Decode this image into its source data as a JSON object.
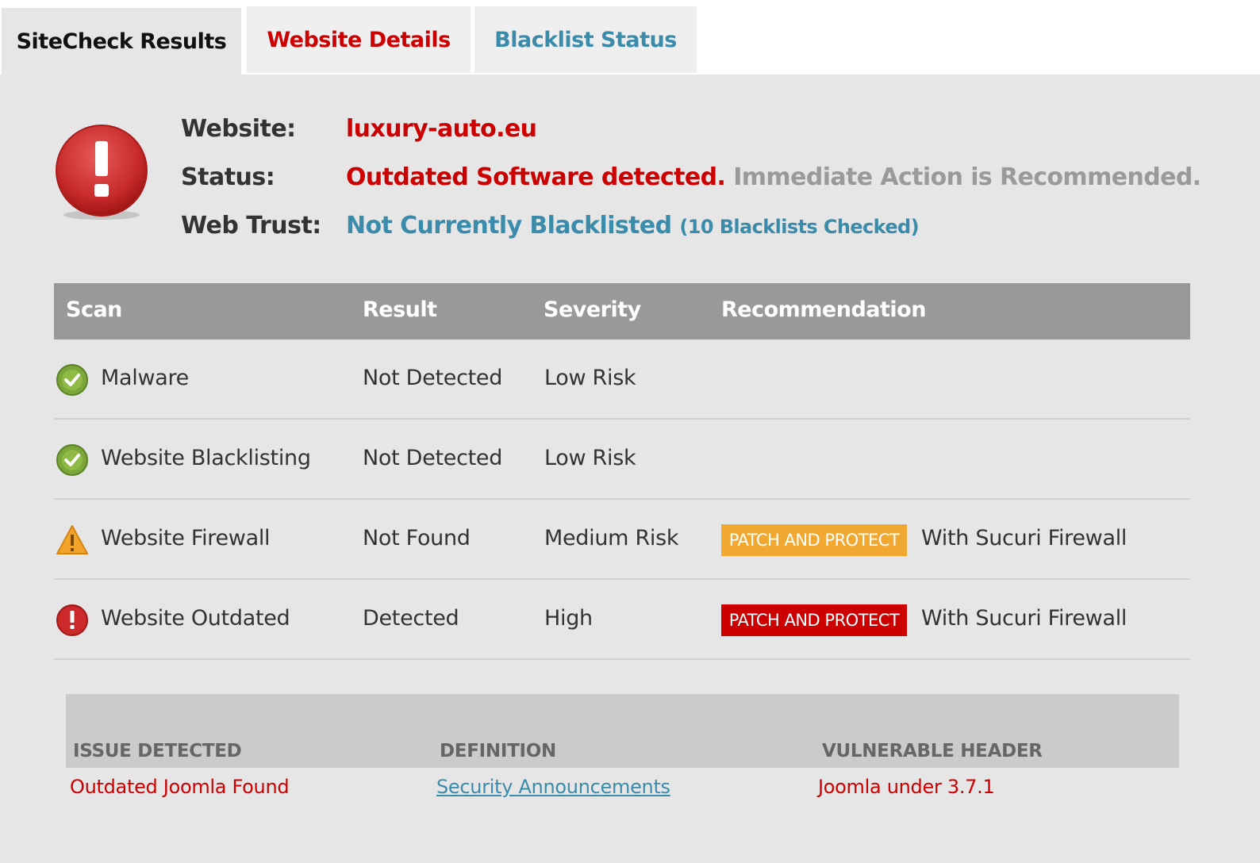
{
  "tabs": [
    {
      "label": "SiteCheck Results",
      "active": true
    },
    {
      "label": "Website Details",
      "active": false
    },
    {
      "label": "Blacklist Status",
      "active": false
    }
  ],
  "summary": {
    "status_icon": "error-exclamation-icon",
    "website_label": "Website:",
    "website_value": "luxury-auto.eu",
    "status_label": "Status:",
    "status_value": "Outdated Software detected.",
    "status_note": "Immediate Action is Recommended.",
    "trust_label": "Web Trust:",
    "trust_value": "Not Currently Blacklisted",
    "trust_note": "(10 Blacklists Checked)"
  },
  "scan_table": {
    "headers": {
      "scan": "Scan",
      "result": "Result",
      "severity": "Severity",
      "recommendation": "Recommendation"
    },
    "rows": [
      {
        "icon": "check-circle-icon",
        "scan": "Malware",
        "result": "Not Detected",
        "severity": "Low Risk",
        "badge": null,
        "recommendation": ""
      },
      {
        "icon": "check-circle-icon",
        "scan": "Website Blacklisting",
        "result": "Not Detected",
        "severity": "Low Risk",
        "badge": null,
        "recommendation": ""
      },
      {
        "icon": "warning-triangle-icon",
        "scan": "Website Firewall",
        "result": "Not Found",
        "severity": "Medium Risk",
        "badge": "PATCH AND PROTECT",
        "badge_color": "#f0a830",
        "recommendation": "With Sucuri Firewall"
      },
      {
        "icon": "error-circle-icon",
        "scan": "Website Outdated",
        "result": "Detected",
        "severity": "High",
        "badge": "PATCH AND PROTECT",
        "badge_color": "#cc0000",
        "recommendation": "With Sucuri Firewall"
      }
    ]
  },
  "issues_table": {
    "headers": {
      "issue": "ISSUE DETECTED",
      "definition": "DEFINITION",
      "header": "VULNERABLE HEADER"
    },
    "rows": [
      {
        "issue": "Outdated Joomla Found",
        "definition": "Security Announcements",
        "header": "Joomla under 3.7.1"
      }
    ]
  },
  "colors": {
    "accent_red": "#cc0000",
    "accent_blue": "#3b8bab",
    "warning_orange": "#f0a830",
    "table_header_gray": "#999999"
  }
}
